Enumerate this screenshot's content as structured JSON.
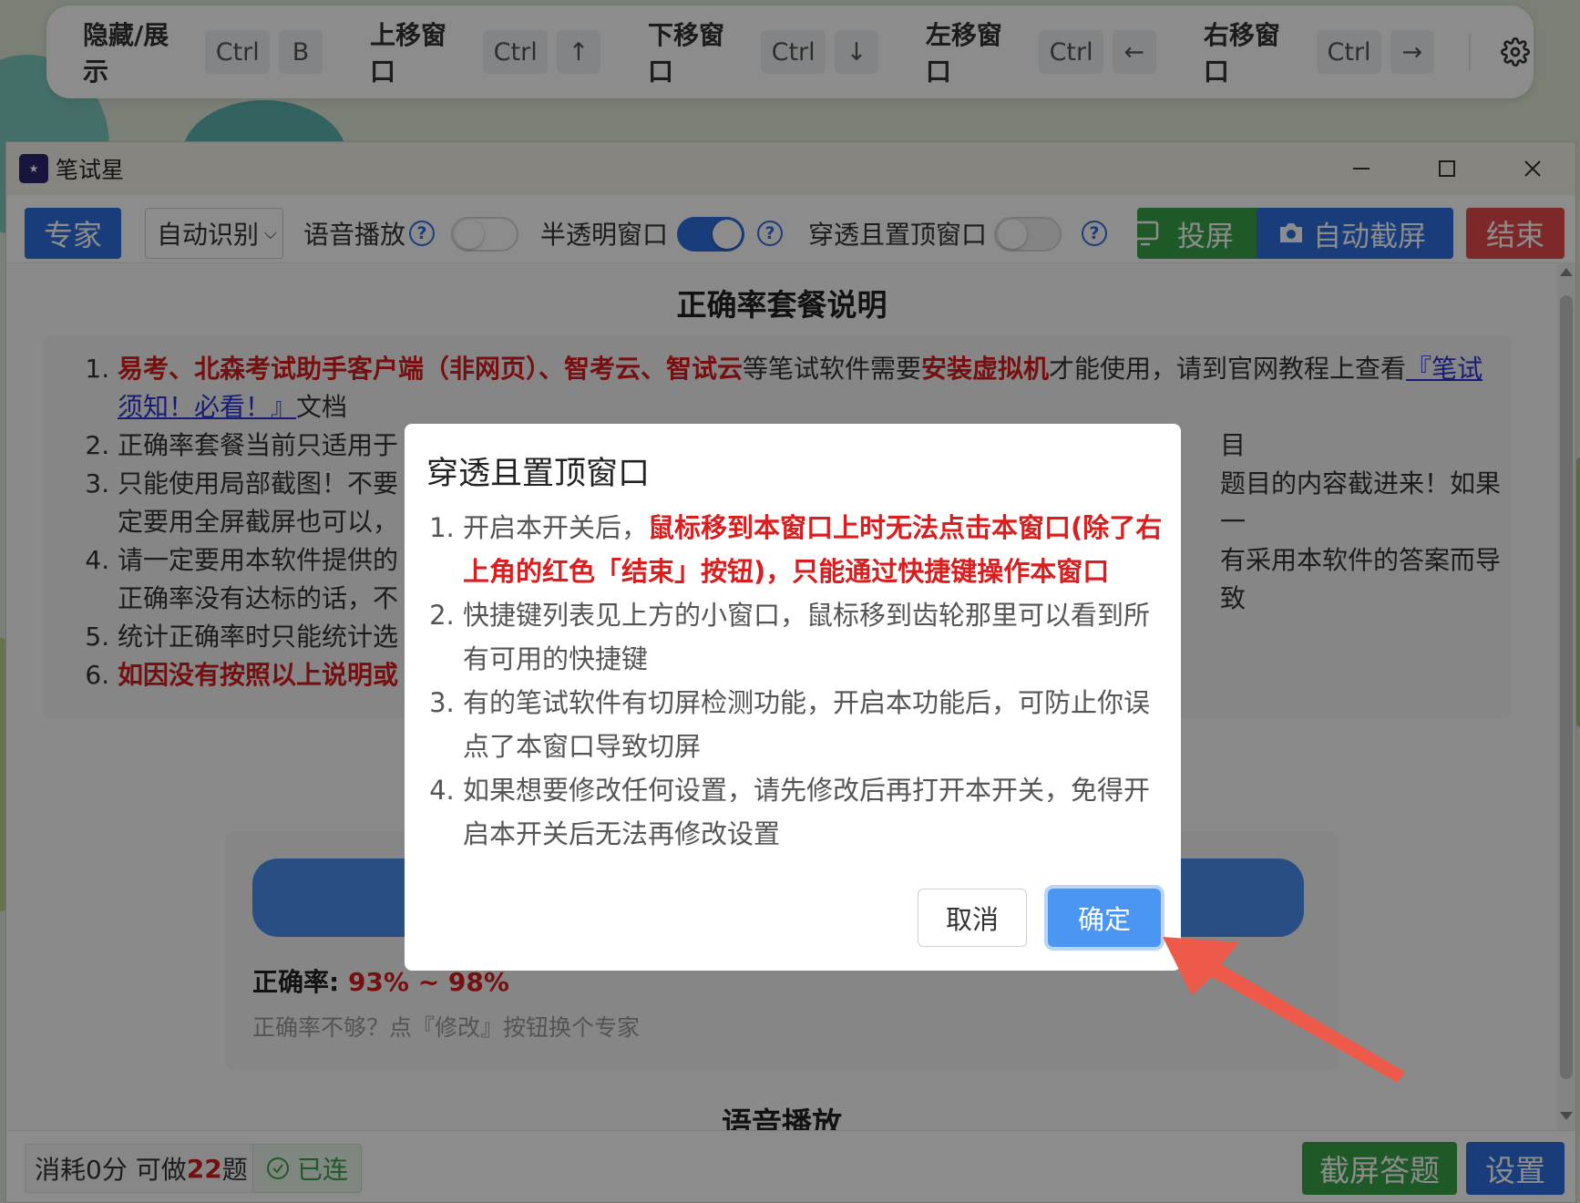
{
  "hotkeys": [
    {
      "label": "隐藏/展示",
      "keys": [
        "Ctrl",
        "B"
      ]
    },
    {
      "label": "上移窗口",
      "keys": [
        "Ctrl",
        "↑"
      ]
    },
    {
      "label": "下移窗口",
      "keys": [
        "Ctrl",
        "↓"
      ]
    },
    {
      "label": "左移窗口",
      "keys": [
        "Ctrl",
        "←"
      ]
    },
    {
      "label": "右移窗口",
      "keys": [
        "Ctrl",
        "→"
      ]
    }
  ],
  "window": {
    "title": "笔试星"
  },
  "toolbar": {
    "expert_label": "专家",
    "language_value": "自动识别",
    "voice_label": "语音播放",
    "voice_on": false,
    "semi_label": "半透明窗口",
    "semi_on": true,
    "pass_label": "穿透且置顶窗口",
    "pass_on": false,
    "cast_label": "投屏",
    "shot_label": "自动截屏",
    "end_label": "结束"
  },
  "content": {
    "section_title": "正确率套餐说明",
    "notes": {
      "n1_red1": "易考、北森考试助手客户端（非网页）、智考云、智试云",
      "n1_mid": "等笔试软件需要",
      "n1_red2": "安装虚拟机",
      "n1_tail": "才能使用，请到官网教程上查看",
      "n1_link": "『笔试须知！必看！』",
      "n1_end": "文档",
      "n2_left": "正确率套餐当前只适用于",
      "n2_right": "目",
      "n3_left": "只能使用局部截图！不要",
      "n3_right": "题目的内容截进来！如果一",
      "n3_line2": "定要用全屏截屏也可以，",
      "n4_left": "请一定要用本软件提供的",
      "n4_right": "有采用本软件的答案而导致",
      "n4_line2": "正确率没有达标的话，不",
      "n5_left": "统计正确率时只能统计选",
      "n6_left": "如因没有按照以上说明或"
    },
    "plan": {
      "acc_label": "正确率: ",
      "acc_value": "93% ~ 98%",
      "tip": "正确率不够？点『修改』按钮换个专家"
    },
    "section2_title": "语音播放"
  },
  "status": {
    "credit_prefix": "消耗0分 可做",
    "credit_count": "22",
    "credit_suffix": "题",
    "connected": "已连",
    "answer_btn": "截屏答题",
    "settings_btn": "设置"
  },
  "modal": {
    "title": "穿透且置顶窗口",
    "item1_plain": "开启本开关后，",
    "item1_red": "鼠标移到本窗口上时无法点击本窗口(除了右上角的红色「结束」按钮)，只能通过快捷键操作本窗口",
    "item2": "快捷键列表见上方的小窗口，鼠标移到齿轮那里可以看到所有可用的快捷键",
    "item3": "有的笔试软件有切屏检测功能，开启本功能后，可防止你误点了本窗口导致切屏",
    "item4": "如果想要修改任何设置，请先修改后再打开本开关，免得开启本开关后无法再修改设置",
    "cancel": "取消",
    "ok": "确定"
  },
  "colors": {
    "primary": "#2f6fe0",
    "success": "#39a24a",
    "danger": "#e34b4b",
    "emphasis_red": "#d81e1e",
    "annotation_arrow": "#ee5a4a"
  }
}
